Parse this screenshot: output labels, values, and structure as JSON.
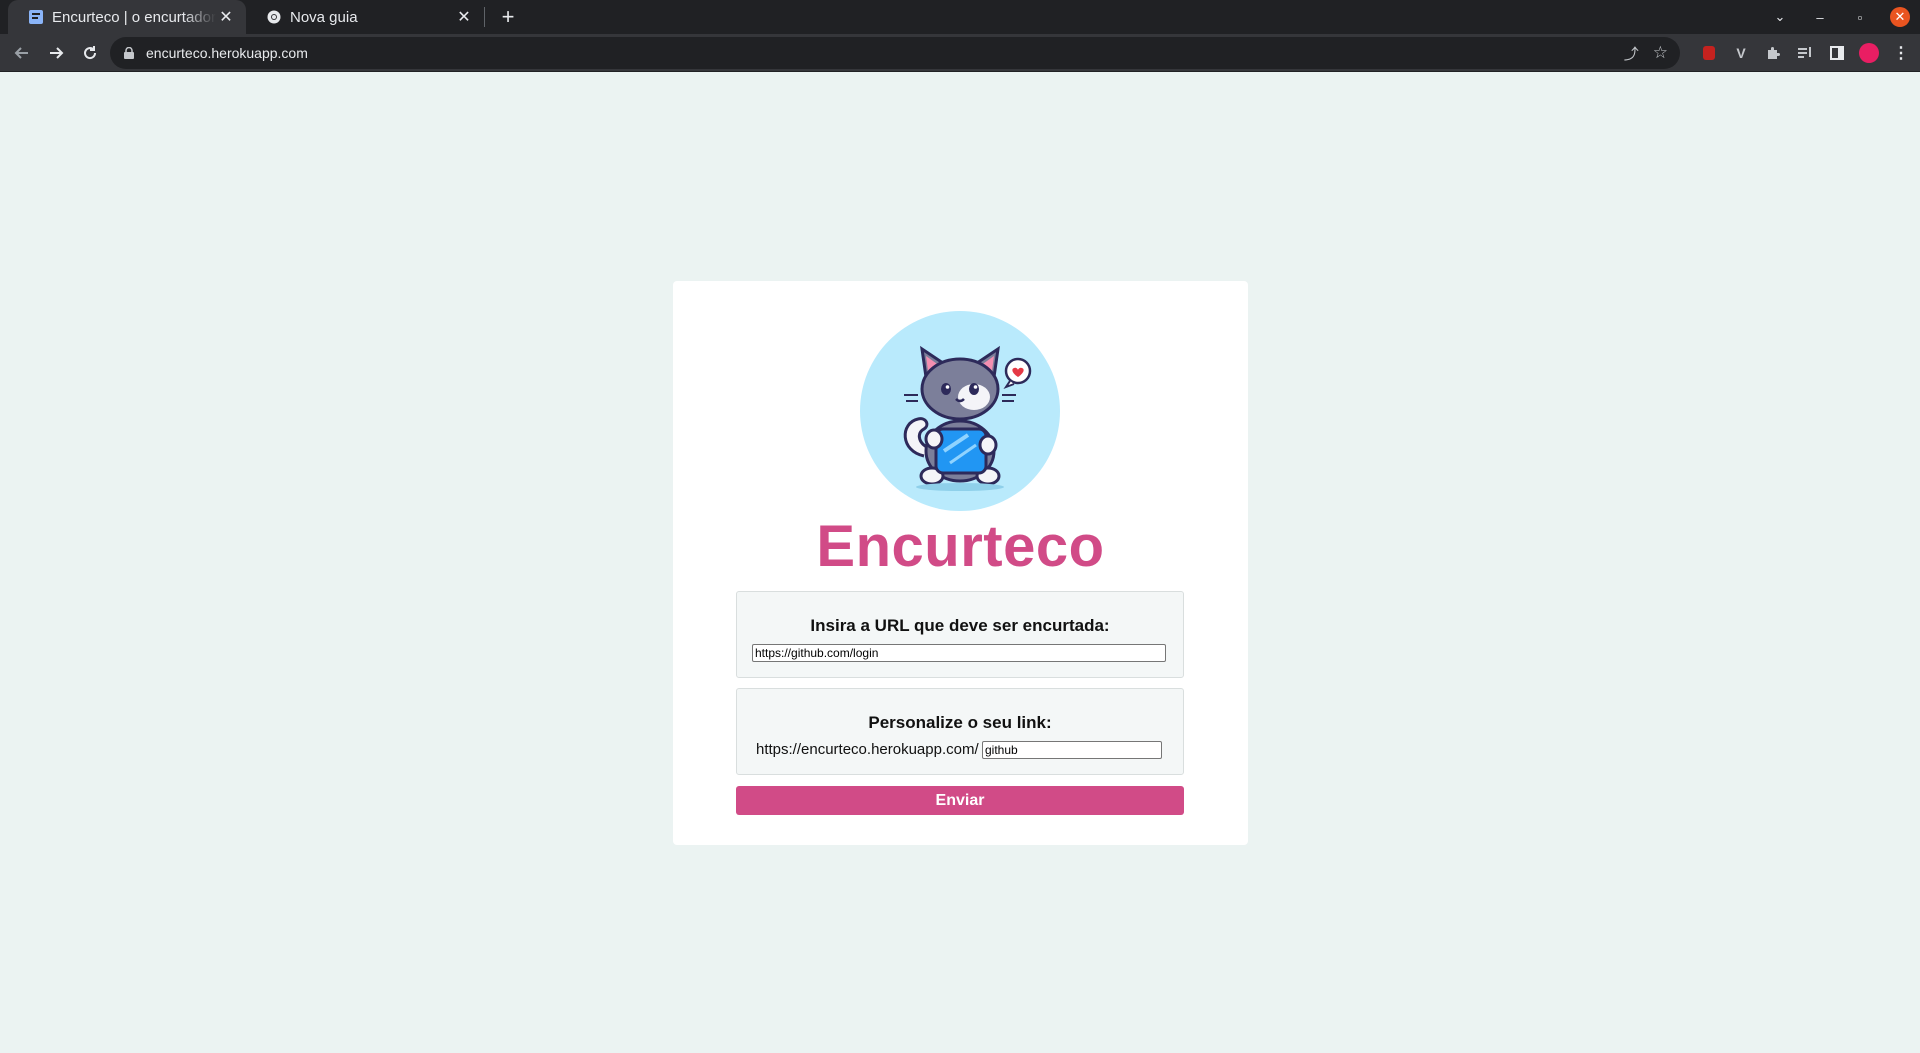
{
  "browser": {
    "tabs": [
      {
        "title": "Encurteco | o encurtador de",
        "active": true
      },
      {
        "title": "Nova guia",
        "active": false
      }
    ],
    "address": "encurteco.herokuapp.com"
  },
  "page": {
    "brand": "Encurteco",
    "url_section": {
      "label": "Insira a URL que deve ser encurtada:",
      "value": "https://github.com/login"
    },
    "custom_section": {
      "label": "Personalize o seu link:",
      "prefix": "https://encurteco.herokuapp.com/",
      "value": "github"
    },
    "submit_label": "Enviar"
  },
  "colors": {
    "accent": "#d14b87",
    "page_bg": "#ebf3f2",
    "logo_bg": "#b9eafc"
  }
}
